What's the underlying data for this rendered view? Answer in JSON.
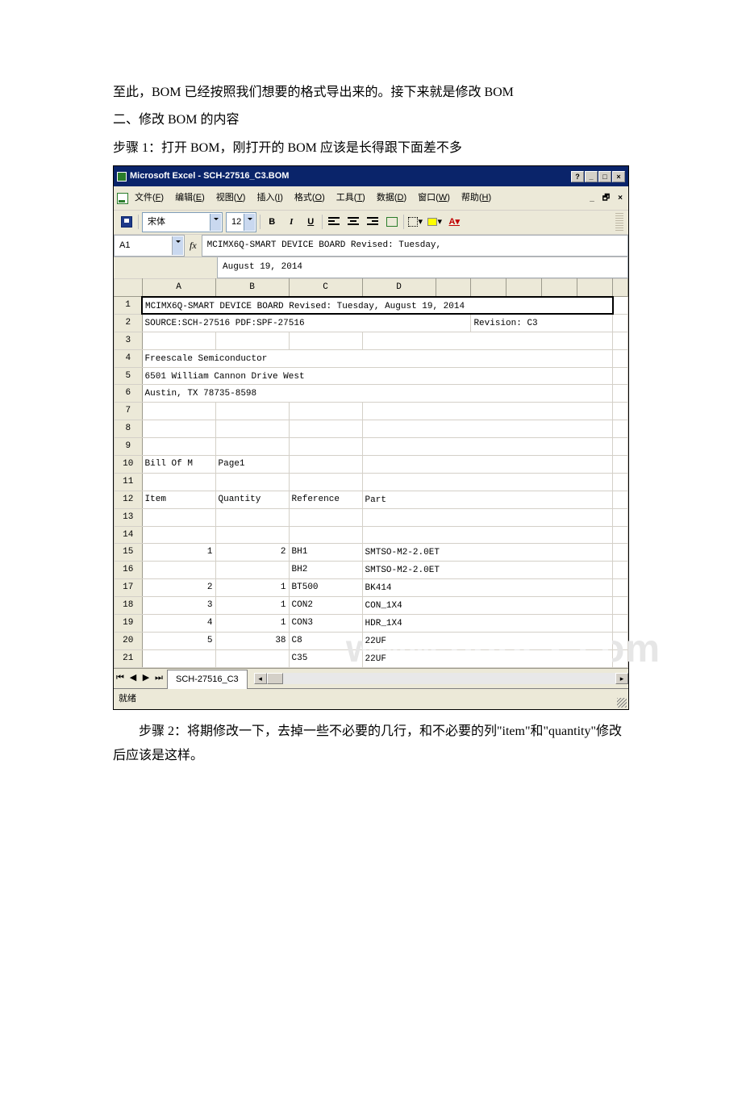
{
  "doc": {
    "p1": "至此，BOM 已经按照我们想要的格式导出来的。接下来就是修改 BOM",
    "p2": "二、修改 BOM 的内容",
    "p3": "步骤 1：打开 BOM，刚打开的 BOM 应该是长得跟下面差不多",
    "p4": "步骤 2：将期修改一下，去掉一些不必要的几行，和不必要的列\"item\"和\"quantity\"修改后应该是这样。"
  },
  "window": {
    "title": "Microsoft Excel - SCH-27516_C3.BOM",
    "menus": {
      "file": {
        "label": "文件",
        "hot": "F"
      },
      "edit": {
        "label": "编辑",
        "hot": "E"
      },
      "view": {
        "label": "视图",
        "hot": "V"
      },
      "insert": {
        "label": "插入",
        "hot": "I"
      },
      "format": {
        "label": "格式",
        "hot": "O"
      },
      "tools": {
        "label": "工具",
        "hot": "T"
      },
      "data": {
        "label": "数据",
        "hot": "D"
      },
      "window": {
        "label": "窗口",
        "hot": "W"
      },
      "help": {
        "label": "帮助",
        "hot": "H"
      }
    },
    "font_name": "宋体",
    "font_size": "12",
    "name_box": "A1",
    "fx": "fx",
    "formula_line1": "MCIMX6Q-SMART DEVICE BOARD  Revised: Tuesday,",
    "formula_line2": "August 19, 2014",
    "columns": [
      "A",
      "B",
      "C",
      "D",
      "",
      "",
      "",
      "",
      ""
    ],
    "rows": [
      {
        "n": "1",
        "a": "MCIMX6Q-SMART DEVICE BOARD  Revised: Tuesday, August 19, 2014",
        "sel": true
      },
      {
        "n": "2",
        "a": "SOURCE:SCH-27516 PDF:SPF-27516",
        "g": "Revision: C3"
      },
      {
        "n": "3"
      },
      {
        "n": "4",
        "a": "Freescale Semiconductor"
      },
      {
        "n": "5",
        "a": "6501 William Cannon Drive West"
      },
      {
        "n": "6",
        "a": "Austin, TX 78735-8598"
      },
      {
        "n": "7"
      },
      {
        "n": "8"
      },
      {
        "n": "9"
      },
      {
        "n": "10",
        "aCell": "Bill Of M",
        "bCell": "Page1"
      },
      {
        "n": "11"
      },
      {
        "n": "12",
        "aCell": "Item",
        "bCell": "Quantity",
        "cCell": "Reference",
        "dCell": "Part"
      },
      {
        "n": "13"
      },
      {
        "n": "14"
      },
      {
        "n": "15",
        "aCell": "1",
        "aR": true,
        "bCell": "2",
        "bR": true,
        "cCell": "BH1",
        "dCell": "SMTSO-M2-2.0ET"
      },
      {
        "n": "16",
        "cCell": "BH2",
        "dCell": "SMTSO-M2-2.0ET"
      },
      {
        "n": "17",
        "aCell": "2",
        "aR": true,
        "bCell": "1",
        "bR": true,
        "cCell": "BT500",
        "dCell": "BK414"
      },
      {
        "n": "18",
        "aCell": "3",
        "aR": true,
        "bCell": "1",
        "bR": true,
        "cCell": "CON2",
        "dCell": "CON_1X4"
      },
      {
        "n": "19",
        "aCell": "4",
        "aR": true,
        "bCell": "1",
        "bR": true,
        "cCell": "CON3",
        "dCell": "HDR_1X4"
      },
      {
        "n": "20",
        "aCell": "5",
        "aR": true,
        "bCell": "38",
        "bR": true,
        "cCell": "C8",
        "dCell": "22UF"
      },
      {
        "n": "21",
        "cCell": "C35",
        "dCell": "22UF",
        "cut": true
      }
    ],
    "sheet_tab": "SCH-27516_C3",
    "status": "就绪",
    "watermark": "www.bdocx.com"
  }
}
